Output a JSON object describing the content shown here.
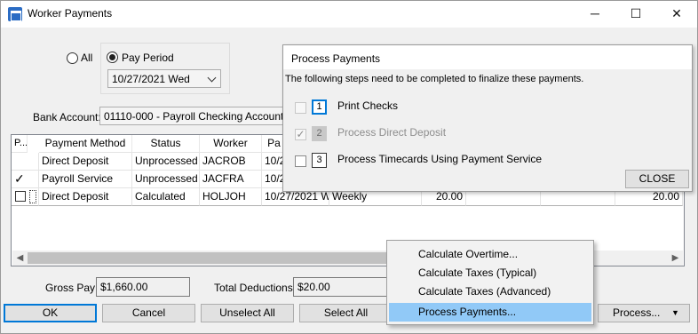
{
  "window": {
    "title": "Worker Payments",
    "minimize": "─",
    "maximize": "☐",
    "close": "✕"
  },
  "filters": {
    "all_label": "All",
    "pay_period_label": "Pay Period",
    "pay_period_value": "10/27/2021 Wed",
    "bank_account_label": "Bank Account:",
    "bank_account_value": "01110-000 - Payroll Checking Account"
  },
  "grid": {
    "headers": [
      "P...",
      "Payment Method",
      "Status",
      "Worker",
      "Pa"
    ],
    "rows": [
      {
        "pay": "",
        "method": "Direct Deposit",
        "status": "Unprocessed",
        "worker": "JACROB",
        "period": "10/2",
        "freq": "",
        "hours": "",
        "amount": ""
      },
      {
        "pay": "✓",
        "method": "Payroll Service",
        "status": "Unprocessed",
        "worker": "JACFRA",
        "period": "10/2",
        "freq": "",
        "hours": "",
        "amount": ""
      },
      {
        "pay": "",
        "method": "Direct Deposit",
        "status": "Calculated",
        "worker": "HOLJOH",
        "period": "10/27/2021 W",
        "freq": "Weekly",
        "hours": "20.00",
        "amount": "20.00"
      }
    ]
  },
  "totals": {
    "gross_pay_label": "Gross Pay:",
    "gross_pay_value": "$1,660.00",
    "total_deductions_label": "Total Deductions:",
    "total_deductions_value": "$20.00"
  },
  "buttons": {
    "ok": "OK",
    "cancel": "Cancel",
    "unselect_all": "Unselect All",
    "select_all": "Select All",
    "process": "Process..."
  },
  "popup": {
    "title": "Process Payments",
    "description": "The following steps need to be completed to finalize these payments.",
    "steps": [
      {
        "num": "1",
        "label": "Print Checks",
        "checked": false,
        "enabled": true
      },
      {
        "num": "2",
        "label": "Process Direct Deposit",
        "checked": true,
        "enabled": false
      },
      {
        "num": "3",
        "label": "Process Timecards Using Payment Service",
        "checked": false,
        "enabled": true
      }
    ],
    "close": "CLOSE"
  },
  "menu": {
    "items": [
      "Calculate Overtime...",
      "Calculate Taxes (Typical)",
      "Calculate Taxes (Advanced)",
      "Process Payments..."
    ],
    "highlighted_index": 3
  }
}
